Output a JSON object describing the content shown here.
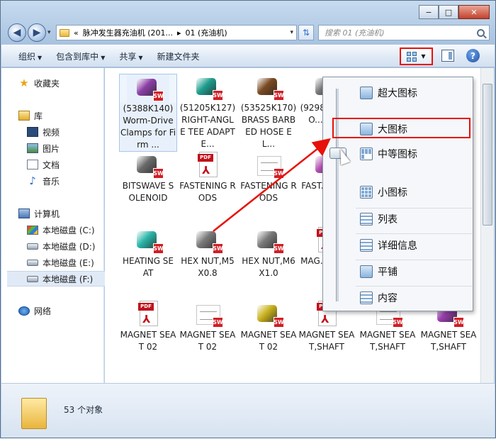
{
  "window": {
    "caption_buttons": {
      "minimize": "−",
      "maximize": "□",
      "close": "✕"
    }
  },
  "address_bar": {
    "back": "◀",
    "forward": "▶",
    "path_prefix": "«",
    "path_segment_1": "脉冲发生器充油机 (201...",
    "separator": "▸",
    "path_segment_2": "01 (充油机)",
    "dropdown": "▾",
    "refresh_icon": "refresh-icon"
  },
  "search": {
    "placeholder": "搜索 01 (充油机)"
  },
  "toolbar": {
    "organize": "组织",
    "include_in_library": "包含到库中",
    "share": "共享",
    "new_folder": "新建文件夹",
    "help": "?"
  },
  "sidebar": {
    "favorites": "收藏夹",
    "libraries": "库",
    "library_items": [
      "视频",
      "图片",
      "文档",
      "音乐"
    ],
    "computer": "计算机",
    "disks": [
      "本地磁盘 (C:)",
      "本地磁盘 (D:)",
      "本地磁盘 (E:)",
      "本地磁盘 (F:)"
    ],
    "network": "网络"
  },
  "files": [
    {
      "label": "(5388K140)Worm-Drive Clamps for Firm ...",
      "kind": "part",
      "color": "#8b3fa6"
    },
    {
      "label": "(51205K127)RIGHT-ANGLE TEE ADAPTE...",
      "kind": "part",
      "color": "#1e9e8e"
    },
    {
      "label": "(53525K170) BRASS BARBED HOSE EL...",
      "kind": "part",
      "color": "#7a4a22"
    },
    {
      "label": "(9298...2 SHO...R S...",
      "kind": "part",
      "color": "#777777"
    },
    {
      "label": "BITSWAVE SOLENOID",
      "kind": "part",
      "color": "#6a6a6a"
    },
    {
      "label": "FASTENING RODS",
      "kind": "pdf"
    },
    {
      "label": "FASTENING RODS",
      "kind": "drawing"
    },
    {
      "label": "FAST...G R...",
      "kind": "part",
      "color": "#b04fb0"
    },
    {
      "label": "HEATING SEAT",
      "kind": "part",
      "color": "#2bb5a8"
    },
    {
      "label": "HEX NUT,M5X0.8",
      "kind": "part",
      "color": "#7a7a7a"
    },
    {
      "label": "HEX NUT,M6X1.0",
      "kind": "part",
      "color": "#7a7a7a"
    },
    {
      "label": "MAG...SEA...",
      "kind": "pdf"
    },
    {
      "label": "MAGNET SEAT 02",
      "kind": "pdf"
    },
    {
      "label": "MAGNET SEAT 02",
      "kind": "drawing"
    },
    {
      "label": "MAGNET SEAT 02",
      "kind": "part",
      "color": "#c9b21e"
    },
    {
      "label": "MAGNET SEAT,SHAFT",
      "kind": "pdf"
    },
    {
      "label": "MAGNET SEAT,SHAFT",
      "kind": "drawing"
    },
    {
      "label": "MAGNET SEAT,SHAFT",
      "kind": "part",
      "color": "#9b3fb0"
    }
  ],
  "status": {
    "count": "53 个对象"
  },
  "view_menu": {
    "items": [
      "超大图标",
      "大图标",
      "中等图标",
      "小图标",
      "列表",
      "详细信息",
      "平铺",
      "内容"
    ],
    "highlighted": "大图标"
  },
  "colors": {
    "highlight_red": "#e8100a",
    "accent_blue": "#2e6fc7",
    "sw_red": "#d11e25",
    "pdf_red": "#c1121c"
  }
}
